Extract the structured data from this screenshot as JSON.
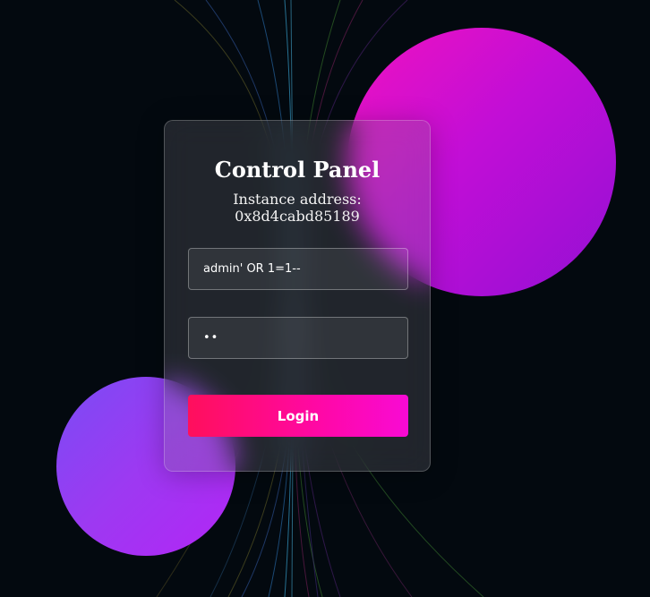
{
  "panel": {
    "title": "Control Panel",
    "instance_label": "Instance address:",
    "instance_address": "0x8d4cabd85189"
  },
  "form": {
    "username_value": "admin' OR 1=1--",
    "password_value": "ab",
    "login_label": "Login"
  },
  "colors": {
    "background": "#03090f",
    "orb_magenta": "#c20ed6",
    "orb_violet": "#9d39f2",
    "button_start": "#ff0f5c",
    "button_end": "#f80ad4"
  }
}
